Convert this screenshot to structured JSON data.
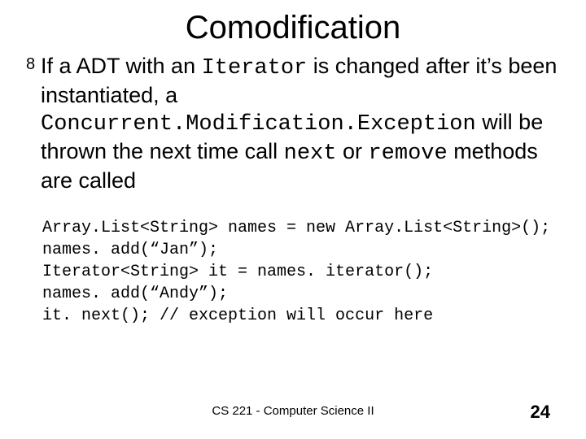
{
  "title": "Comodification",
  "bullet": {
    "seg1": "If a ADT with an ",
    "code1": "Iterator",
    "seg2": " is changed after it’s been instantiated, a ",
    "code2": "Concurrent.Modification.Exception",
    "seg3": " will be thrown the next time call ",
    "code3": "next",
    "seg4": " or ",
    "code4": "remove",
    "seg5": " methods are called"
  },
  "code": {
    "l1": "Array.List<String> names = new Array.List<String>();",
    "l2": "names. add(“Jan”);",
    "l3": "Iterator<String> it = names. iterator();",
    "l4": "names. add(“Andy”);",
    "l5": "it. next(); // exception will occur here"
  },
  "footer": "CS 221 - Computer Science II",
  "pagenum": "24"
}
